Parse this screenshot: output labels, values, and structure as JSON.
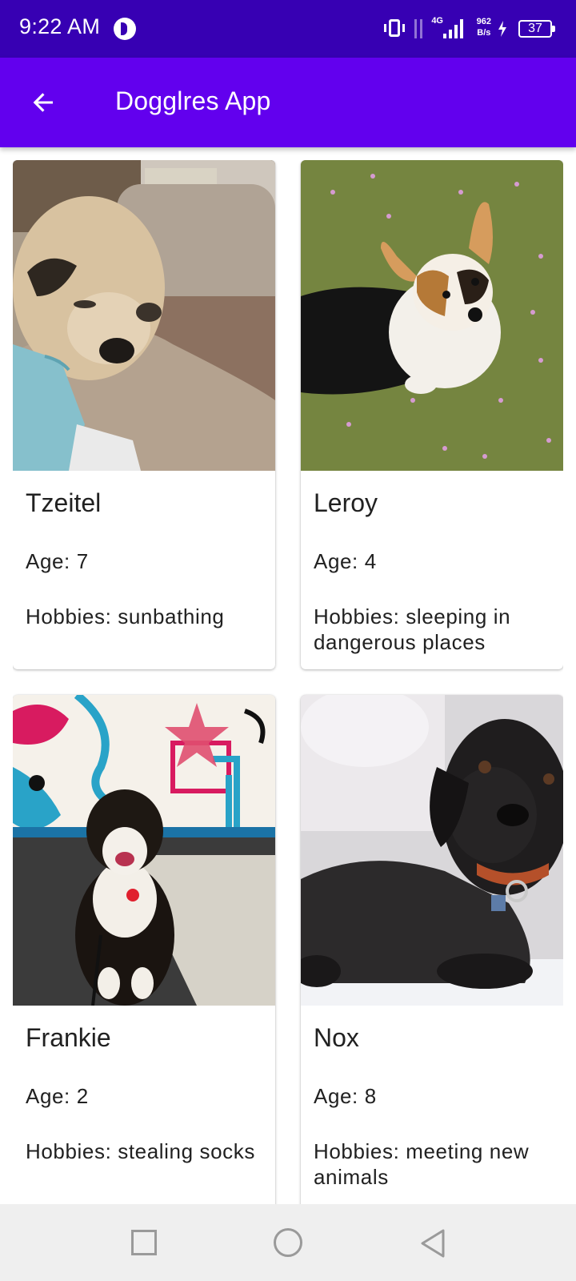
{
  "status_bar": {
    "time": "9:22 AM",
    "network_type": "4G",
    "speed_value": "962",
    "speed_unit": "B/s",
    "battery_level": "37",
    "icons": [
      "app-notification-icon",
      "vibrate-icon",
      "data-arrows-icon",
      "signal-icon",
      "charging-bolt-icon",
      "battery-icon"
    ]
  },
  "app_bar": {
    "title": "Dogglres App",
    "back_icon": "arrow-back-icon",
    "color": "#6200ee"
  },
  "dogs": [
    {
      "name": "Tzeitel",
      "age": "Age: 7",
      "hobbies": "Hobbies: sunbathing",
      "photo": "pug-sleeping-on-couch"
    },
    {
      "name": "Leroy",
      "age": "Age: 4",
      "hobbies": "Hobbies: sleeping in dangerous places",
      "photo": "corgi-on-grass"
    },
    {
      "name": "Frankie",
      "age": "Age: 2",
      "hobbies": "Hobbies: stealing socks",
      "photo": "puppy-in-front-of-graffiti"
    },
    {
      "name": "Nox",
      "age": "Age: 8",
      "hobbies": "Hobbies: meeting new animals",
      "photo": "black-dog-lying-down"
    }
  ],
  "nav_bar": {
    "icons": [
      "recent-apps-icon",
      "home-icon",
      "back-icon"
    ]
  },
  "colors": {
    "status_bar": "#3700b3",
    "app_bar": "#6200ee",
    "nav_bar": "#efefef"
  }
}
